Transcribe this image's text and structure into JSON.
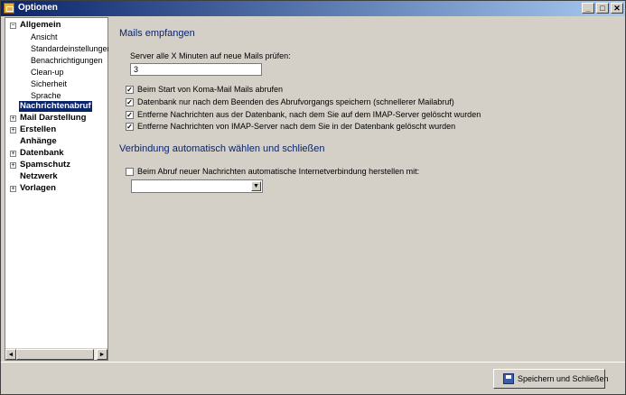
{
  "window": {
    "title": "Optionen",
    "minimize": "_",
    "maximize": "□",
    "close": "✕"
  },
  "sidebar": {
    "items": [
      {
        "label": "Allgemein",
        "expander": "−"
      },
      {
        "label": "Ansicht"
      },
      {
        "label": "Standardeinstellungen"
      },
      {
        "label": "Benachrichtigungen"
      },
      {
        "label": "Clean-up"
      },
      {
        "label": "Sicherheit"
      },
      {
        "label": "Sprache"
      },
      {
        "label": "Nachrichtenabruf"
      },
      {
        "label": "Mail Darstellung",
        "expander": "+"
      },
      {
        "label": "Erstellen",
        "expander": "+"
      },
      {
        "label": "Anhänge"
      },
      {
        "label": "Datenbank",
        "expander": "+"
      },
      {
        "label": "Spamschutz",
        "expander": "+"
      },
      {
        "label": "Netzwerk"
      },
      {
        "label": "Vorlagen",
        "expander": "+"
      }
    ],
    "scroll_left": "◄",
    "scroll_right": "►"
  },
  "main": {
    "section1_title": "Mails empfangen",
    "server_label": "Server alle X Minuten auf neue Mails prüfen:",
    "server_value": "3",
    "checkboxes": [
      {
        "label": "Beim Start von Koma-Mail Mails abrufen",
        "mark": "✓"
      },
      {
        "label": "Datenbank nur nach dem Beenden des Abrufvorgangs speichern (schnellerer Mailabruf)",
        "mark": "✓"
      },
      {
        "label": "Entferne Nachrichten aus der Datenbank, nach dem Sie auf dem IMAP-Server gelöscht wurden",
        "mark": "✓"
      },
      {
        "label": "Entferne Nachrichten von IMAP-Server nach dem Sie in der Datenbank gelöscht wurden",
        "mark": "✓"
      }
    ],
    "section2_title": "Verbindung automatisch wählen und schließen",
    "auto_connect_label": "Beim Abruf neuer Nachrichten automatische Internetverbindung herstellen mit:",
    "dropdown_value": "",
    "dropdown_arrow": "▼"
  },
  "footer": {
    "save_label": "Speichern und Schließen"
  }
}
